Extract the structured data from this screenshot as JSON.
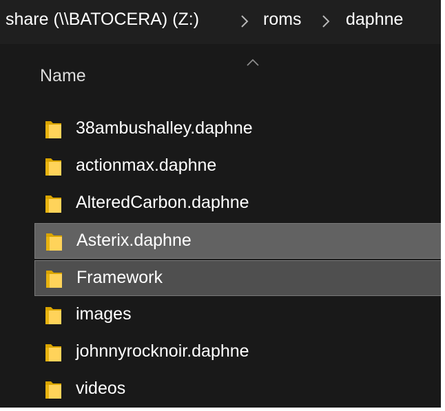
{
  "breadcrumb": [
    {
      "label": "share (\\\\BATOCERA) (Z:)"
    },
    {
      "label": "roms"
    },
    {
      "label": "daphne"
    }
  ],
  "column_header": {
    "name_label": "Name",
    "sort_icon": "chevron-up-icon"
  },
  "files": [
    {
      "name": "38ambushalley.daphne",
      "icon": "folder-icon",
      "selected": false
    },
    {
      "name": "actionmax.daphne",
      "icon": "folder-icon",
      "selected": false
    },
    {
      "name": "AlteredCarbon.daphne",
      "icon": "folder-icon",
      "selected": false
    },
    {
      "name": "Asterix.daphne",
      "icon": "folder-icon",
      "selected": true
    },
    {
      "name": "Framework",
      "icon": "folder-icon",
      "selected": true
    },
    {
      "name": "images",
      "icon": "folder-icon",
      "selected": false
    },
    {
      "name": "johnnyrocknoir.daphne",
      "icon": "folder-icon",
      "selected": false
    },
    {
      "name": "videos",
      "icon": "folder-icon",
      "selected": false
    }
  ],
  "colors": {
    "background": "#191919",
    "selected": "#626262",
    "folder_dark": "#d9a400",
    "folder_light": "#ffd35a"
  }
}
